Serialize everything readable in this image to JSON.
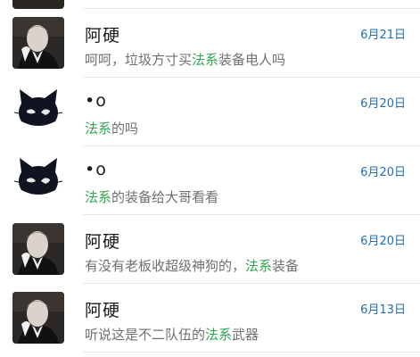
{
  "conversations": [
    {
      "name": "阿硬",
      "date": "6月21日",
      "avatar": "man-portrait",
      "msg_pre": "呵呵，垃圾方寸买",
      "msg_kw": "法系",
      "msg_post": "装备电人吗"
    },
    {
      "name": "•o",
      "date": "6月20日",
      "avatar": "black-cat",
      "msg_pre": "",
      "msg_kw": "法系",
      "msg_post": "的吗"
    },
    {
      "name": "•o",
      "date": "6月20日",
      "avatar": "black-cat",
      "msg_pre": "",
      "msg_kw": "法系",
      "msg_post": "的装备给大哥看看"
    },
    {
      "name": "阿硬",
      "date": "6月20日",
      "avatar": "man-portrait",
      "msg_pre": "有没有老板收超级神狗的，",
      "msg_kw": "法系",
      "msg_post": "装备"
    },
    {
      "name": "阿硬",
      "date": "6月13日",
      "avatar": "man-portrait",
      "msg_pre": "听说这是不二队伍的",
      "msg_kw": "法系",
      "msg_post": "武器"
    }
  ],
  "colors": {
    "keyword": "#2fa84f",
    "date": "#1f6fb0",
    "separator": "#e6e6e6"
  }
}
